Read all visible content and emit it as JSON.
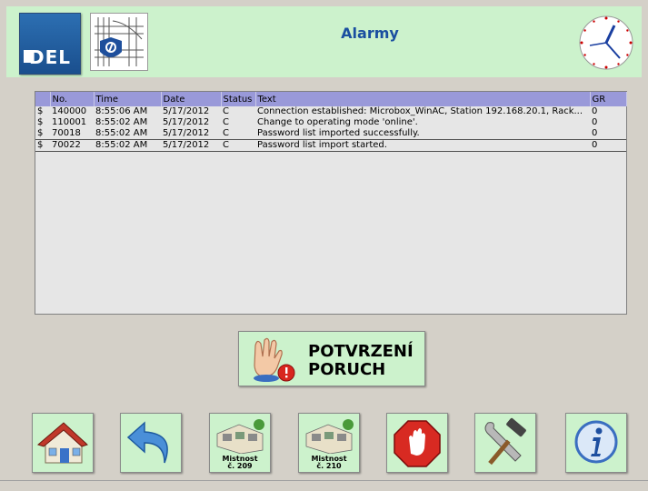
{
  "header": {
    "title": "Alarmy",
    "logo_text": "DEL"
  },
  "alarm_table": {
    "columns": [
      "",
      "No.",
      "Time",
      "Date",
      "Status",
      "Text",
      "GR"
    ],
    "rows": [
      {
        "flag": "$",
        "no": "140000",
        "time": "8:55:06 AM",
        "date": "5/17/2012",
        "status": "C",
        "text": "Connection established: Microbox_WinAC, Station 192.168.20.1, Rack...",
        "gr": "0"
      },
      {
        "flag": "$",
        "no": "110001",
        "time": "8:55:02 AM",
        "date": "5/17/2012",
        "status": "C",
        "text": "Change to operating mode 'online'.",
        "gr": "0"
      },
      {
        "flag": "$",
        "no": "70018",
        "time": "8:55:02 AM",
        "date": "5/17/2012",
        "status": "C",
        "text": "Password list imported successfully.",
        "gr": "0"
      },
      {
        "flag": "$",
        "no": "70022",
        "time": "8:55:02 AM",
        "date": "5/17/2012",
        "status": "C",
        "text": "Password list import started.",
        "gr": "0"
      }
    ]
  },
  "ack_button": {
    "line1": "POTVRZENÍ",
    "line2": "PORUCH"
  },
  "nav": {
    "room_209_line1": "Mistnost",
    "room_209_line2": "č. 209",
    "room_210_line1": "Mistnost",
    "room_210_line2": "č. 210"
  }
}
